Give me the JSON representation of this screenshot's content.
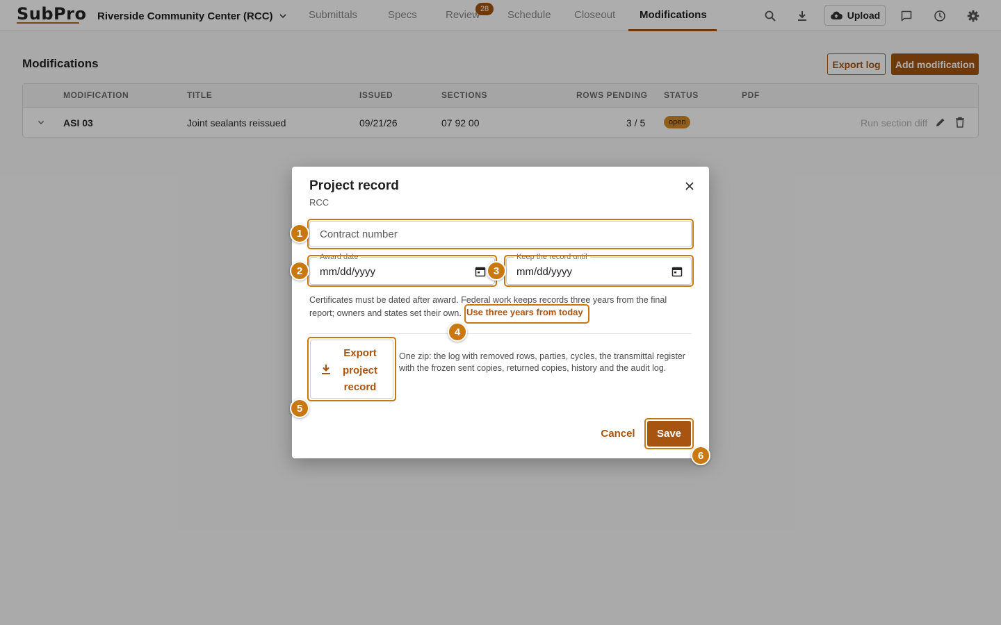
{
  "app": {
    "logo_text": "SubPro",
    "project": "Riverside Community Center (RCC)",
    "nav": [
      {
        "label": "Submittals",
        "icon": "none"
      },
      {
        "label": "Specs",
        "icon": "none"
      },
      {
        "label": "Review",
        "badge": "28"
      },
      {
        "label": "Schedule"
      },
      {
        "label": "Closeout"
      },
      {
        "label": "Modifications",
        "active": true
      }
    ],
    "upload_label": "Upload",
    "icons": [
      "search-icon",
      "download-icon",
      "upload-cloud-icon",
      "comment-icon",
      "history-icon",
      "settings-icon"
    ],
    "accent_color": "#a65410"
  },
  "page": {
    "title": "Modifications",
    "export_log_label": "Export log",
    "add_modification_label": "Add modification"
  },
  "table": {
    "headers": [
      "MODIFICATION",
      "TITLE",
      "ISSUED",
      "SECTIONS",
      "ROWS PENDING",
      "STATUS",
      "PDF"
    ],
    "rows": [
      {
        "modification": "ASI 03",
        "title": "Joint sealants reissued",
        "issued": "09/21/26",
        "sections": "07 92 00",
        "rows_pending": "3 / 5",
        "status": "open",
        "action_label": "Run section diff"
      }
    ]
  },
  "modal": {
    "title": "Project record",
    "subtitle": "RCC",
    "contract_placeholder": "Contract number",
    "award_date_label": "Award date",
    "award_date_value": "mm/dd/yyyy",
    "keep_until_label": "Keep the record until",
    "keep_until_value": "mm/dd/yyyy",
    "help_text": "Certificates must be dated after award. Federal work keeps records three years from the final report; owners and states set their own.",
    "help_link": "Use three years from today",
    "export_label": "Export project record",
    "export_desc": "One zip: the log with removed rows, parties, cycles, the transmittal register with the frozen sent copies, returned copies, history and the audit log.",
    "cancel_label": "Cancel",
    "save_label": "Save"
  },
  "markers": [
    "1",
    "2",
    "3",
    "4",
    "5",
    "6"
  ],
  "highlight_color": "#c8780e"
}
